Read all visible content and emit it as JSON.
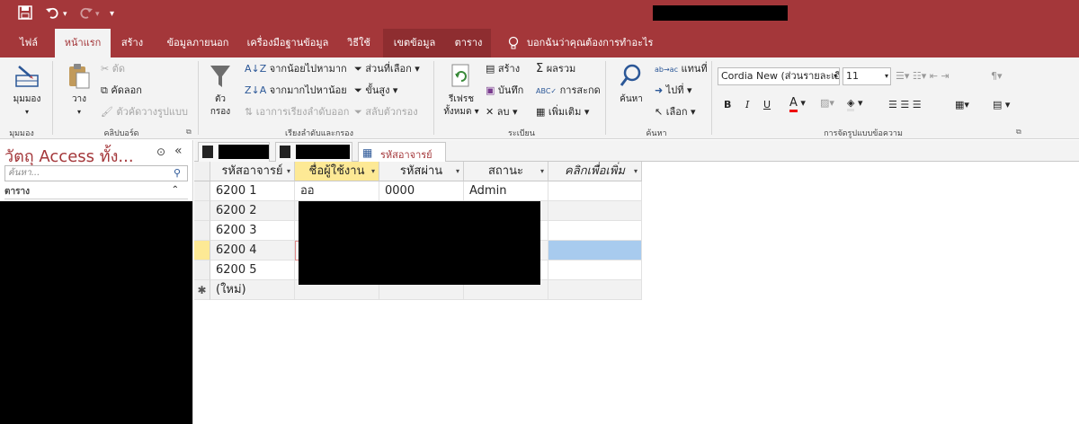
{
  "qat": {
    "save_icon": "save-icon",
    "undo_icon": "undo-icon",
    "redo_icon": "redo-icon",
    "customize_icon": "customize-qat-icon"
  },
  "tabs": [
    {
      "label": "ไฟล์"
    },
    {
      "label": "หน้าแรก"
    },
    {
      "label": "สร้าง"
    },
    {
      "label": "ข้อมูลภายนอก"
    },
    {
      "label": "เครื่องมือฐานข้อมูล"
    },
    {
      "label": "วิธีใช้"
    },
    {
      "label": "เขตข้อมูล"
    },
    {
      "label": "ตาราง"
    }
  ],
  "tell_me": "บอกฉันว่าคุณต้องการทำอะไร",
  "ribbon": {
    "views": {
      "view": "มุมมอง",
      "group": "มุมมอง"
    },
    "clipboard": {
      "paste": "วาง",
      "cut": "ตัด",
      "copy": "คัดลอก",
      "format_painter": "ตัวคัดวางรูปแบบ",
      "group": "คลิปบอร์ด"
    },
    "sort": {
      "filter": "ตัวกรอง",
      "asc": "จากน้อยไปหามาก",
      "desc": "จากมากไปหาน้อย",
      "remove_sort": "เอาการเรียงลำดับออก",
      "selection": "ส่วนที่เลือก",
      "advanced": "ขั้นสูง",
      "toggle_filter": "สลับตัวกรอง",
      "group": "เรียงลำดับและกรอง"
    },
    "records": {
      "refresh_line1": "รีเฟรช",
      "refresh_line2": "ทั้งหมด",
      "new": "สร้าง",
      "save": "บันทึก",
      "delete": "ลบ",
      "totals": "ผลรวม",
      "spelling": "การสะกด",
      "more": "เพิ่มเติม",
      "group": "ระเบียน"
    },
    "find": {
      "find": "ค้นหา",
      "replace": "แทนที่",
      "goto": "ไปที่",
      "select": "เลือก",
      "group": "ค้นหา"
    },
    "format": {
      "font": "Cordia New (ส่วนรายละเอี",
      "size": "11",
      "bold": "B",
      "italic": "I",
      "underline": "U",
      "group": "การจัดรูปแบบข้อความ"
    }
  },
  "nav": {
    "title": "วัตถุ Access ทั้ง...",
    "search_placeholder": "ค้นหา...",
    "group": "ตาราง"
  },
  "doc_tabs": [
    {
      "label": ""
    },
    {
      "label": ""
    },
    {
      "label": "รหัสอาจารย์"
    }
  ],
  "table": {
    "columns": [
      "รหัสอาจารย์",
      "ชื่อผู้ใช้งาน",
      "รหัสผ่าน",
      "สถานะ",
      "คลิกเพื่อเพิ่ม"
    ],
    "rows": [
      [
        "6200 1",
        "ออ",
        "0000",
        "Admin"
      ],
      [
        "6200 2",
        "",
        "",
        ""
      ],
      [
        "6200 3",
        "",
        "",
        ""
      ],
      [
        "6200 4",
        "",
        "",
        ""
      ],
      [
        "6200 5",
        "",
        "",
        ""
      ]
    ],
    "new_row": "(ใหม่)",
    "new_marker": "✱"
  },
  "colors": {
    "accent": "#a4373a",
    "ribbon_bg": "#f3f3f3",
    "header_sel": "#fde995",
    "row_sel": "#a8cbee"
  }
}
